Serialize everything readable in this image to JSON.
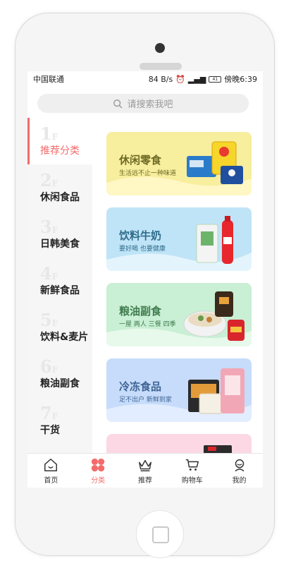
{
  "status_bar": {
    "carrier": "中国联通",
    "speed": "84 B/s",
    "battery": "41",
    "time": "傍晚6:39"
  },
  "search": {
    "placeholder": "请搜索我吧"
  },
  "sidebar": {
    "items": [
      {
        "num": "1",
        "suffix": "F",
        "label": "推荐分类",
        "active": true
      },
      {
        "num": "2",
        "suffix": "F",
        "label": "休闲食品"
      },
      {
        "num": "3",
        "suffix": "F",
        "label": "日韩美食"
      },
      {
        "num": "4",
        "suffix": "F",
        "label": "新鲜食品"
      },
      {
        "num": "5",
        "suffix": "F",
        "label": "饮料&麦片"
      },
      {
        "num": "6",
        "suffix": "F",
        "label": "粮油副食"
      },
      {
        "num": "7",
        "suffix": "F",
        "label": "干货"
      }
    ]
  },
  "cards": [
    {
      "title": "休闲零食",
      "subtitle": "生活远不止一种味道",
      "bg": "#f7ee9e",
      "wave": "#fff7c4",
      "title_color": "#6e6b24"
    },
    {
      "title": "饮料牛奶",
      "subtitle": "要好喝 也要健康",
      "bg": "#bfe4f7",
      "wave": "#e3f4fd",
      "title_color": "#2f6c8c"
    },
    {
      "title": "粮油副食",
      "subtitle": "一屋 两人 三餐 四季",
      "bg": "#c9efd4",
      "wave": "#e6f9ea",
      "title_color": "#3f7c4f"
    },
    {
      "title": "冷冻食品",
      "subtitle": "足不出户 新鲜到家",
      "bg": "#c6dcfa",
      "wave": "#e2edff",
      "title_color": "#3f6496"
    },
    {
      "title": "",
      "subtitle": "",
      "bg": "#fcd8e5",
      "wave": "#fdeaf1",
      "title_color": "#8c3c5a"
    }
  ],
  "tabs": [
    {
      "label": "首页",
      "icon": "home-icon"
    },
    {
      "label": "分类",
      "icon": "category-icon",
      "active": true
    },
    {
      "label": "推荐",
      "icon": "crown-icon"
    },
    {
      "label": "购物车",
      "icon": "cart-icon"
    },
    {
      "label": "我的",
      "icon": "user-icon"
    }
  ],
  "colors": {
    "accent": "#f46b6b"
  }
}
